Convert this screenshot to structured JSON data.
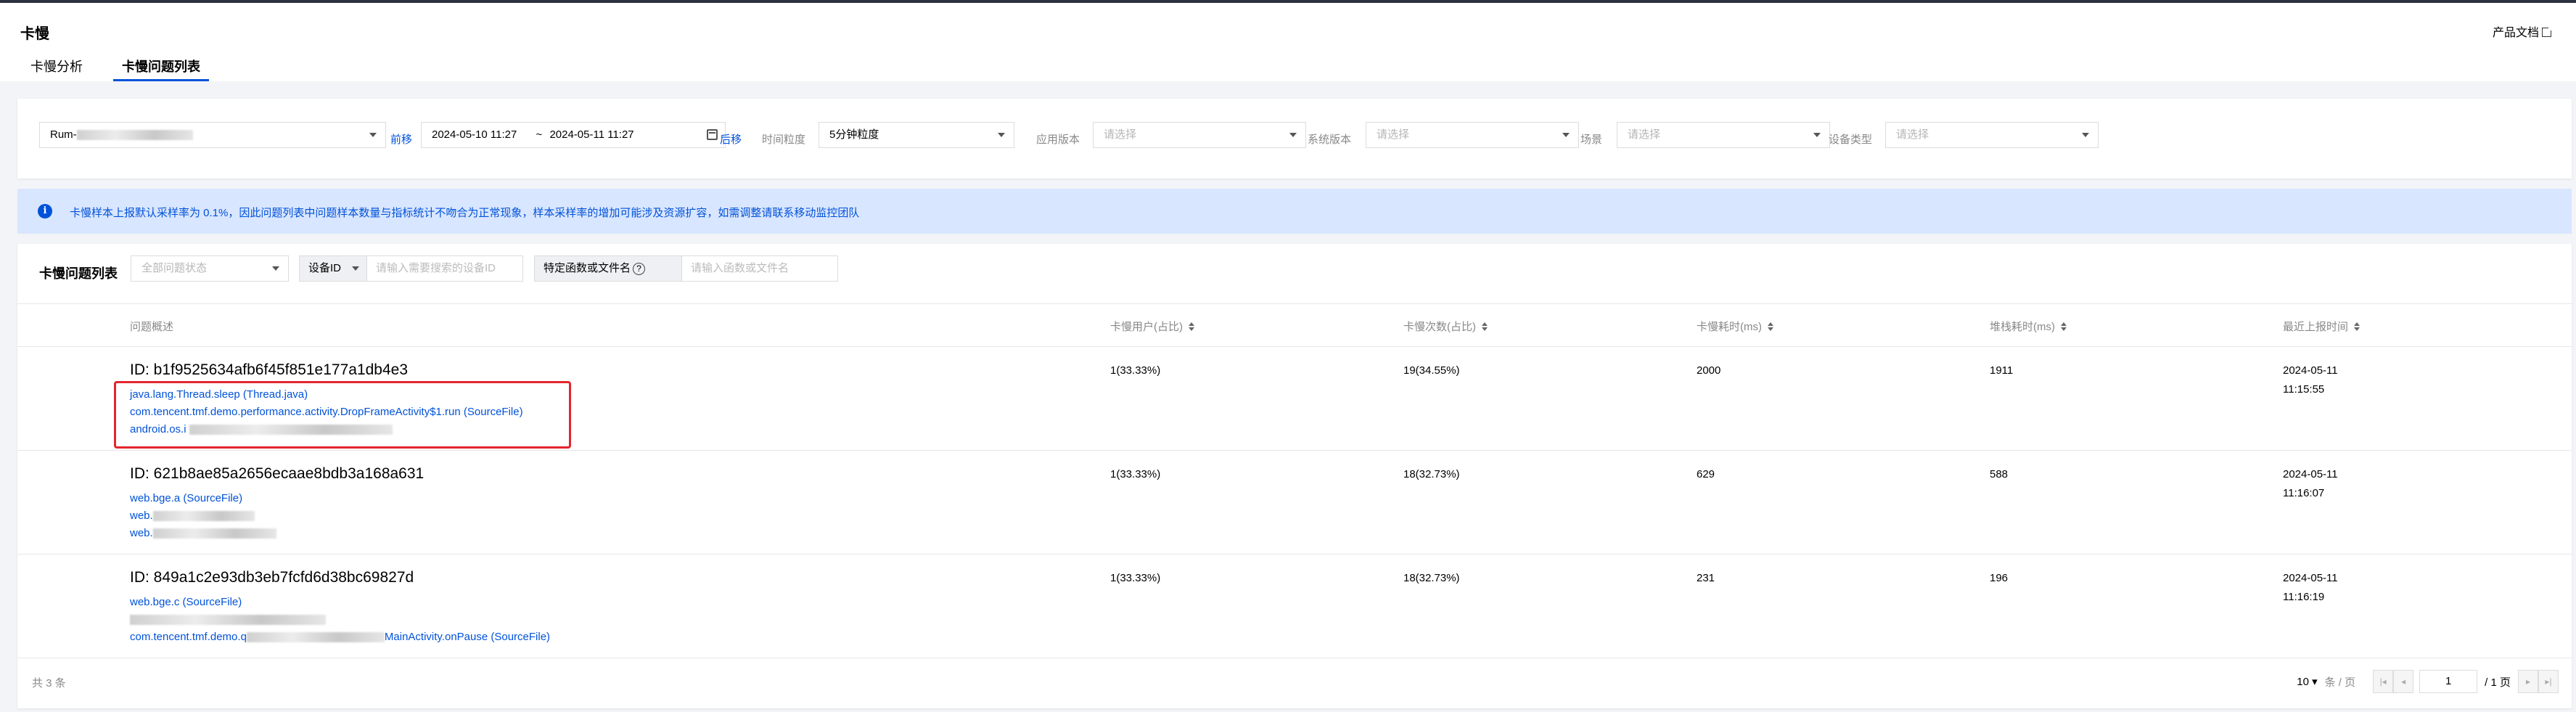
{
  "header": {
    "title": "卡慢",
    "docs_link": "产品文档",
    "tabs": [
      {
        "label": "卡慢分析",
        "active": false
      },
      {
        "label": "卡慢问题列表",
        "active": true
      }
    ]
  },
  "filters": {
    "app_select_prefix": "Rum-",
    "prev_link": "前移",
    "date_start": "2024-05-10 11:27",
    "date_sep": "~",
    "date_end": "2024-05-11 11:27",
    "next_link": "后移",
    "granularity_label": "时间粒度",
    "granularity_value": "5分钟粒度",
    "app_version_label": "应用版本",
    "app_version_placeholder": "请选择",
    "os_version_label": "系统版本",
    "os_version_placeholder": "请选择",
    "scene_label": "场景",
    "scene_placeholder": "请选择",
    "device_type_label": "设备类型",
    "device_type_placeholder": "请选择"
  },
  "notice": {
    "icon": "info-icon",
    "text": "卡慢样本上报默认采样率为 0.1%，因此问题列表中问题样本数量与指标统计不吻合为正常现象，样本采样率的增加可能涉及资源扩容，如需调整请联系移动监控团队"
  },
  "list": {
    "title": "卡慢问题列表",
    "status_placeholder": "全部问题状态",
    "device_id_label": "设备ID",
    "device_id_placeholder": "请输入需要搜索的设备ID",
    "func_label": "特定函数或文件名",
    "func_placeholder": "请输入函数或文件名",
    "columns": {
      "overview": "问题概述",
      "users": "卡慢用户(占比)",
      "count": "卡慢次数(占比)",
      "cost": "卡慢耗时(ms)",
      "stack_cost": "堆栈耗时(ms)",
      "last_report": "最近上报时间"
    },
    "rows": [
      {
        "id": "ID:  b1f9525634afb6f45f851e177a1db4e3",
        "frames": [
          "java.lang.Thread.sleep (Thread.java)",
          "com.tencent.tmf.demo.performance.activity.DropFrameActivity$1.run (SourceFile)",
          "android.os.i"
        ],
        "users": "1(33.33%)",
        "count": "19(34.55%)",
        "cost": "2000",
        "stack_cost": "1911",
        "date": "2024-05-11",
        "time": "11:15:55"
      },
      {
        "id": "ID:  621b8ae85a2656ecaae8bdb3a168a631",
        "frames": [
          "web.bge.a (SourceFile)",
          "web.",
          "web."
        ],
        "users": "1(33.33%)",
        "count": "18(32.73%)",
        "cost": "629",
        "stack_cost": "588",
        "date": "2024-05-11",
        "time": "11:16:07"
      },
      {
        "id": "ID:  849a1c2e93db3eb7fcfd6d38bc69827d",
        "frames": [
          "web.bge.c (SourceFile)",
          "",
          "com.tencent.tmf.demo.q"
        ],
        "frame3_tail": "MainActivity.onPause (SourceFile)",
        "users": "1(33.33%)",
        "count": "18(32.73%)",
        "cost": "231",
        "stack_cost": "196",
        "date": "2024-05-11",
        "time": "11:16:19"
      }
    ],
    "total": "共 3 条",
    "page_size": "10",
    "page_size_unit": "条 / 页",
    "current_page": "1",
    "total_pages": "/ 1 页"
  }
}
